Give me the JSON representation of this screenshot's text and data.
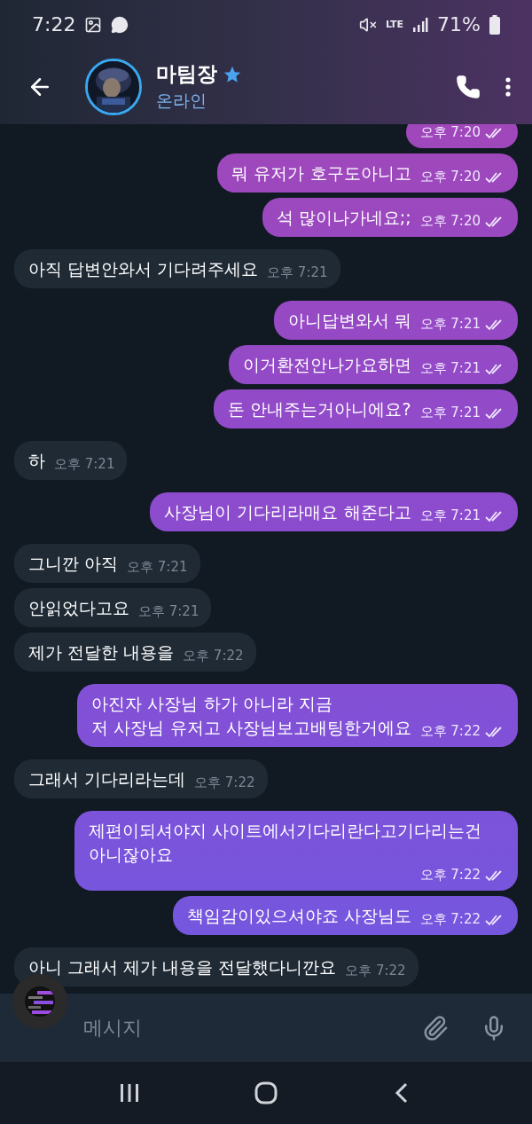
{
  "status_bar": {
    "time": "7:22",
    "network": "LTE",
    "battery": "71%"
  },
  "header": {
    "title": "마팀장",
    "status": "온라인",
    "verified": true
  },
  "messages": [
    {
      "kind": "outgoing",
      "time": "오후 7:20",
      "read": true
    },
    {
      "kind": "outgoing",
      "text": "뭐 유저가 호구도아니고",
      "time": "오후 7:20",
      "read": true
    },
    {
      "kind": "outgoing",
      "text": "석 많이나가네요;;",
      "time": "오후 7:20",
      "read": true
    },
    {
      "kind": "incoming",
      "text": "아직 답변안와서 기다려주세요",
      "time": "오후 7:21"
    },
    {
      "kind": "outgoing",
      "text": "아니답변와서 뭐",
      "time": "오후 7:21",
      "read": true
    },
    {
      "kind": "outgoing",
      "text": "이거환전안나가요하면",
      "time": "오후 7:21",
      "read": true
    },
    {
      "kind": "outgoing",
      "text": "돈 안내주는거아니에요?",
      "time": "오후 7:21",
      "read": true
    },
    {
      "kind": "incoming",
      "text": "하",
      "time": "오후 7:21"
    },
    {
      "kind": "outgoing",
      "text": "사장님이 기다리라매요 해준다고",
      "time": "오후 7:21",
      "read": true
    },
    {
      "kind": "incoming",
      "text": "그니깐 아직",
      "time": "오후 7:21"
    },
    {
      "kind": "incoming",
      "text": "안읽었다고요",
      "time": "오후 7:21"
    },
    {
      "kind": "incoming",
      "text": "제가 전달한 내용을",
      "time": "오후 7:22"
    },
    {
      "kind": "outgoing",
      "text": "아진자 사장님 하가 아니라 지금\n저 사장님 유저고 사장님보고배팅한거에요",
      "time": "오후 7:22",
      "read": true
    },
    {
      "kind": "incoming",
      "text": "그래서 기다리라는데",
      "time": "오후 7:22"
    },
    {
      "kind": "outgoing",
      "text": "제편이되셔야지 사이트에서기다리란다고기다리는건 아니잖아요",
      "time": "오후 7:22",
      "read": true
    },
    {
      "kind": "outgoing",
      "text": "책임감이있으셔야죠 사장님도",
      "time": "오후 7:22",
      "read": true
    },
    {
      "kind": "incoming",
      "text": "아니 그래서 제가 내용을 전달했다니깐요",
      "time": "오후 7:22"
    }
  ],
  "composer": {
    "placeholder": "메시지"
  }
}
